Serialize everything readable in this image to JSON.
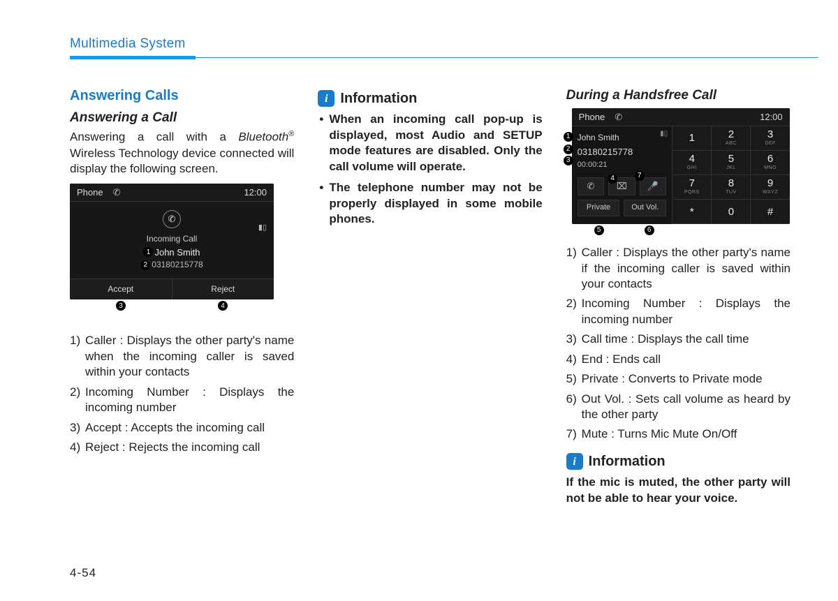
{
  "header": {
    "title": "Multimedia System"
  },
  "page_number": "4-54",
  "col1": {
    "h1": "Answering Calls",
    "h2": "Answering a Call",
    "intro_pre": "Answering a call with a ",
    "intro_bt": "Bluetooth",
    "intro_sup": "®",
    "intro_post": " Wireless Technology device connected will display the following screen.",
    "screen": {
      "phone_label": "Phone",
      "clock": "12:00",
      "incoming_label": "Incoming Call",
      "caller": "John Smith",
      "number": "03180215778",
      "accept": "Accept",
      "reject": "Reject"
    },
    "list": [
      "Caller : Displays the other party's name when the incoming caller is saved within your contacts",
      "Incoming Number : Displays the incoming number",
      "Accept : Accepts the incoming call",
      "Reject : Rejects the incoming call"
    ]
  },
  "col2": {
    "info_title": "Information",
    "bullets": [
      "When an incoming call pop-up is displayed, most Audio and SETUP mode features are disabled. Only the call volume will operate.",
      "The telephone number may not be properly displayed in some mobile phones."
    ]
  },
  "col3": {
    "h2": "During a Handsfree Call",
    "screen": {
      "phone_label": "Phone",
      "clock": "12:00",
      "caller": "John Smith",
      "number": "03180215778",
      "calltime": "00:00:21",
      "private": "Private",
      "outvol": "Out Vol.",
      "keypad": [
        {
          "d": "1",
          "s": ""
        },
        {
          "d": "2",
          "s": "ABC"
        },
        {
          "d": "3",
          "s": "DEF"
        },
        {
          "d": "4",
          "s": "GHI"
        },
        {
          "d": "5",
          "s": "JKL"
        },
        {
          "d": "6",
          "s": "MNO"
        },
        {
          "d": "7",
          "s": "PQRS"
        },
        {
          "d": "8",
          "s": "TUV"
        },
        {
          "d": "9",
          "s": "WXYZ"
        },
        {
          "d": "*",
          "s": ""
        },
        {
          "d": "0",
          "s": ""
        },
        {
          "d": "#",
          "s": ""
        }
      ]
    },
    "list": [
      "Caller : Displays the other party's name if the incoming caller is saved within your contacts",
      "Incoming Number : Displays the incoming number",
      "Call time : Displays the call time",
      "End : Ends call",
      "Private : Converts to Private mode",
      "Out Vol. : Sets call volume as heard by the other party",
      "Mute : Turns Mic Mute On/Off"
    ],
    "info_title": "Information",
    "info_para": "If the mic is muted, the other party will not be able to hear your voice."
  },
  "callouts": {
    "c1": "1",
    "c2": "2",
    "c3": "3",
    "c4": "4",
    "c5": "5",
    "c6": "6",
    "c7": "7",
    "n1": "1)",
    "n2": "2)",
    "n3": "3)",
    "n4": "4)",
    "n5": "5)",
    "n6": "6)",
    "n7": "7)"
  }
}
